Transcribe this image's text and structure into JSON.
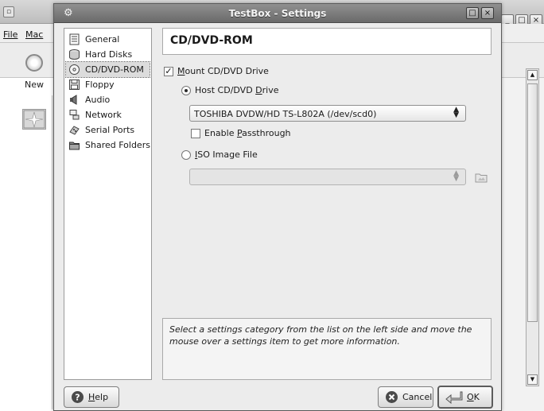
{
  "background_window": {
    "menu": [
      "File",
      "Mac"
    ],
    "toolbar_new_label": "New"
  },
  "dialog": {
    "title": "TestBox - Settings",
    "categories": [
      {
        "label": "General",
        "icon": "general-icon"
      },
      {
        "label": "Hard Disks",
        "icon": "hard-disk-icon"
      },
      {
        "label": "CD/DVD-ROM",
        "icon": "cd-dvd-icon",
        "selected": true
      },
      {
        "label": "Floppy",
        "icon": "floppy-icon"
      },
      {
        "label": "Audio",
        "icon": "audio-icon"
      },
      {
        "label": "Network",
        "icon": "network-icon"
      },
      {
        "label": "Serial Ports",
        "icon": "serial-port-icon"
      },
      {
        "label": "Shared Folders",
        "icon": "shared-folder-icon"
      }
    ],
    "page_title": "CD/DVD-ROM",
    "mount": {
      "label_prefix": "",
      "label_underlined": "M",
      "label_rest": "ount CD/DVD Drive",
      "checked": true
    },
    "host_drive": {
      "label_prefix": "Host CD/DVD ",
      "label_underlined": "D",
      "label_rest": "rive",
      "selected": true
    },
    "host_drive_value": "TOSHIBA DVDW/HD TS-L802A (/dev/scd0)",
    "passthrough": {
      "label_prefix": "Enable ",
      "label_underlined": "P",
      "label_rest": "assthrough",
      "checked": false
    },
    "iso": {
      "label_prefix": "",
      "label_underlined": "I",
      "label_rest": "SO Image File",
      "selected": false
    },
    "iso_value": "",
    "info_text": "Select a settings category from the list on the left side and move the mouse over a settings item to get more information.",
    "help": {
      "underlined": "H",
      "rest": "elp"
    },
    "cancel_label": "Cancel",
    "ok": {
      "underlined": "O",
      "rest": "K"
    }
  },
  "colors": {
    "dialog_bg": "#ececec",
    "titlebar": "#7a7a7a",
    "selection": "#dcdcdc"
  }
}
